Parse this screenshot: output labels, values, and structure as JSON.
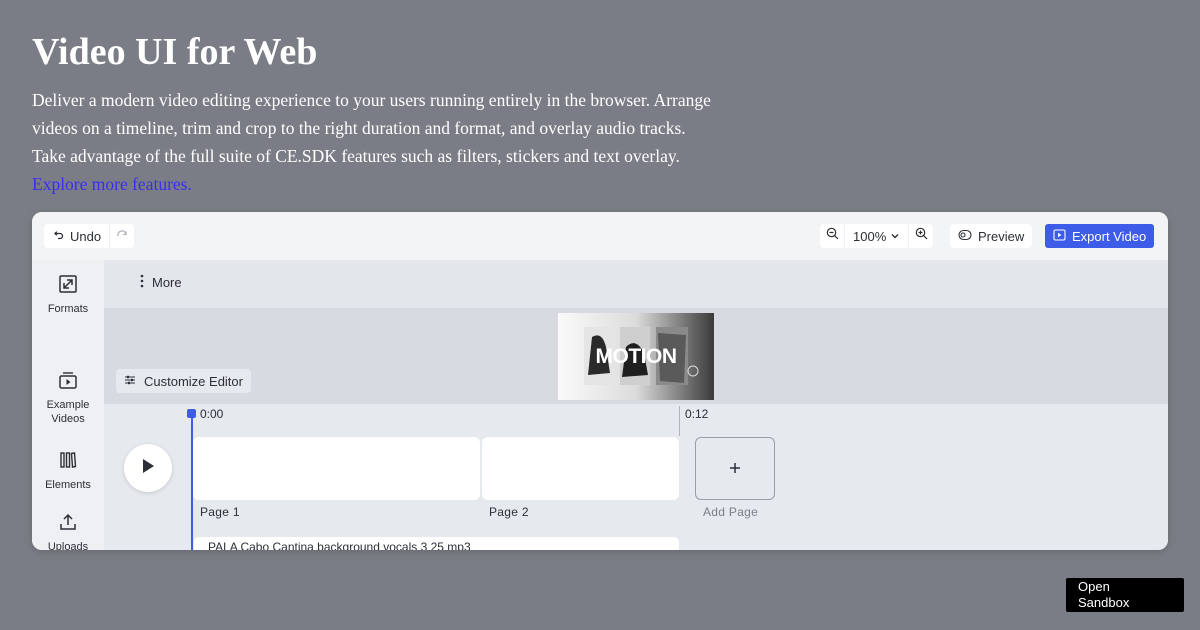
{
  "hero": {
    "title": "Video UI for Web",
    "description_lines": [
      "Deliver a modern video editing experience to your users running entirely in the browser. Arrange",
      "videos on a timeline, trim and crop to the right duration and format, and overlay audio tracks.",
      "Take advantage of the full suite of CE.SDK features such as filters, stickers and text overlay."
    ],
    "link_label": "Explore more features."
  },
  "toolbar": {
    "undo_label": "Undo",
    "zoom_value": "100%",
    "preview_label": "Preview",
    "export_label": "Export Video"
  },
  "sidebar": {
    "items": [
      {
        "label": "Formats",
        "icon": "formats-icon"
      },
      {
        "label": "Example\nVideos",
        "icon": "video-library-icon"
      },
      {
        "label": "Elements",
        "icon": "elements-icon"
      },
      {
        "label": "Uploads",
        "icon": "upload-icon"
      }
    ]
  },
  "subbar": {
    "more_label": "More"
  },
  "canvas": {
    "customize_label": "Customize Editor",
    "thumbnail_text": "MOTION"
  },
  "timeline": {
    "start_time": "0:00",
    "end_time": "0:12",
    "pages": [
      {
        "label": "Page 1"
      },
      {
        "label": "Page 2"
      }
    ],
    "add_page_label": "Add Page",
    "audio_track": "PALA Cabo Cantina background vocals 3 25 mp3"
  },
  "sandbox": {
    "label_line1": "Open",
    "label_line2": "Sandbox"
  },
  "colors": {
    "accent": "#3d5ce8",
    "link": "#3a2ef0",
    "page_bg": "#7a7d85"
  }
}
